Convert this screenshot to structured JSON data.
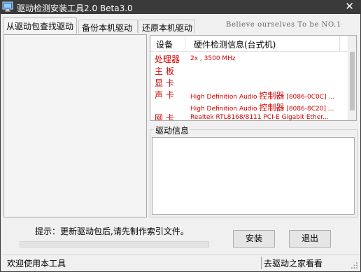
{
  "window": {
    "title": "驱动检测安装工具2.0 Beta3.0",
    "close_label": "✕",
    "app_icon": "computer-monitor-icon"
  },
  "tabs": [
    {
      "label": "从驱动包查找驱动",
      "active": true
    },
    {
      "label": "备份本机驱动",
      "active": false
    },
    {
      "label": "还原本机驱动",
      "active": false
    }
  ],
  "slogan": "Believe ourselves  To be NO.1",
  "device_list": {
    "columns": [
      "设备",
      "硬件检测信息(台式机)"
    ],
    "rows": [
      {
        "device": "处理器",
        "info_prefix": "2x , 3500 MHz",
        "info_big": "",
        "info_suffix": ""
      },
      {
        "device": "主 板",
        "info_prefix": "",
        "info_big": "",
        "info_suffix": ""
      },
      {
        "device": "显 卡",
        "info_prefix": "",
        "info_big": "",
        "info_suffix": ""
      },
      {
        "device": "声 卡",
        "info_prefix": "High Definition Audio ",
        "info_big": "控制器",
        "info_suffix": " [8086-0C0C] ..."
      },
      {
        "device": "",
        "info_prefix": "High Definition Audio ",
        "info_big": "控制器",
        "info_suffix": " [8086-8C20] ..."
      },
      {
        "device": "网 卡",
        "info_prefix": "Realtek RTL8168/8111 PCI-E Gigabit Ether...",
        "info_big": "",
        "info_suffix": ""
      }
    ],
    "highlight_color": "#d40000"
  },
  "driver_info": {
    "legend": "驱动信息"
  },
  "tip": "提示：更新驱动包后,请先制作索引文件。",
  "progress": {
    "value": 0
  },
  "buttons": {
    "install": "安装",
    "exit": "退出"
  },
  "status": {
    "left": "欢迎使用本工具",
    "right": "去驱动之家看看"
  }
}
